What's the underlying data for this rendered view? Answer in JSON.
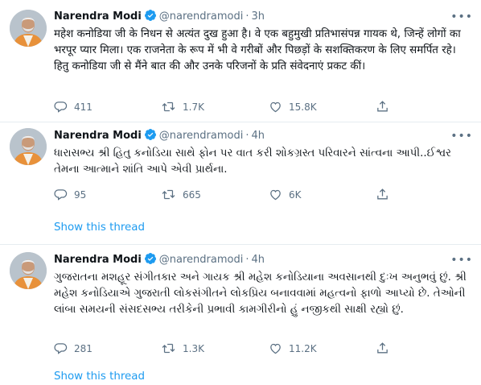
{
  "tweets": [
    {
      "author_name": "Narendra Modi",
      "handle": "@narendramodi",
      "separator": "·",
      "time": "3h",
      "text": "महेश कनोडिया जी के निधन से अत्यंत दुख हुआ है। वे एक बहुमुखी प्रतिभासंपन्न गायक थे, जिन्हें लोगों का भरपूर प्यार मिला। एक राजनेता के रूप में भी वे गरीबों और पिछड़ों के सशक्तिकरण के लिए समर्पित रहे। हितु कनोडिया जी से मैंने बात की और उनके परिजनों के प्रति संवेदनाएं प्रकट कीं।",
      "replies": "411",
      "retweets": "1.7K",
      "likes": "15.8K",
      "show_thread": ""
    },
    {
      "author_name": "Narendra Modi",
      "handle": "@narendramodi",
      "separator": "·",
      "time": "4h",
      "text": "ધારાસભ્ય શ્રી હિતુ કનોડિયા સાથે ફોન પર વાત કરી શોકગ્રસ્ત પરિવારને સાંત્વના આપી..ઈશ્વર તેમના આત્માને શાંતિ આપે એવી પ્રાર્થના.",
      "replies": "95",
      "retweets": "665",
      "likes": "6K",
      "show_thread": "Show this thread"
    },
    {
      "author_name": "Narendra Modi",
      "handle": "@narendramodi",
      "separator": "·",
      "time": "4h",
      "text": "ગુજરાતના મશહૂર સંગીતકાર અને ગાયક શ્રી મહેશ કનોડિયાના અવસાનથી દુઃખ અનુભવું છું. શ્રી મહેશ કનોડિયાએ ગુજરાતી લોકસંગીતને લોકપ્રિય બનાવવામાં મહત્વનો ફાળો આપ્યો છે. તેઓની લાંબા સમયની સંસદસભ્ય તરીકેની પ્રભાવી કામગીરીનો હું નજીકથી સાક્ષી રહ્યો છું.",
      "replies": "281",
      "retweets": "1.3K",
      "likes": "11.2K",
      "show_thread": "Show this thread"
    }
  ],
  "colors": {
    "accent": "#1d9bf0",
    "muted": "#5b7083",
    "divider": "#e6ecf0",
    "saffron": "#e8913a"
  },
  "icons": [
    "verified-badge-icon",
    "more-icon",
    "reply-icon",
    "retweet-icon",
    "like-icon",
    "share-icon"
  ]
}
